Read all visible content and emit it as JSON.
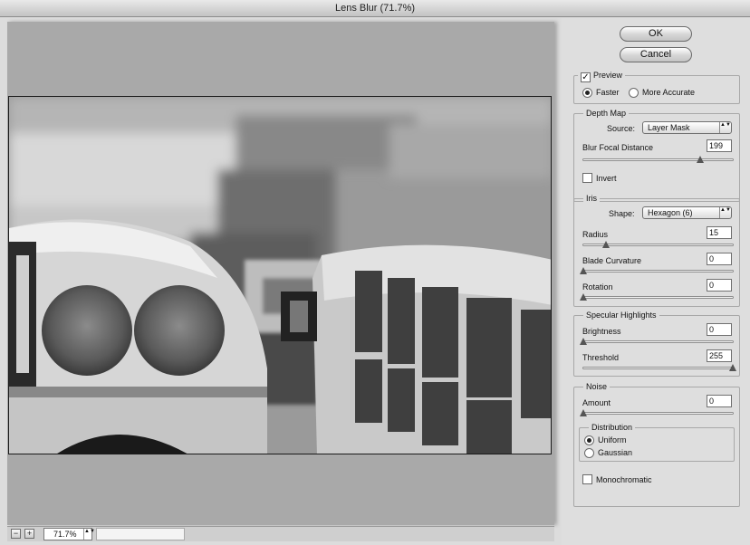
{
  "window": {
    "title": "Lens Blur (71.7%)"
  },
  "statusbar": {
    "zoom_out": "−",
    "zoom_in": "+",
    "zoom_value": "71.7%",
    "stepper": "▲▼"
  },
  "buttons": {
    "ok": "OK",
    "cancel": "Cancel"
  },
  "preview": {
    "label": "Preview",
    "checked": true,
    "faster": "Faster",
    "more_accurate": "More Accurate",
    "mode_selected": "Faster"
  },
  "depth_map": {
    "title": "Depth Map",
    "source_label": "Source:",
    "source_value": "Layer Mask",
    "blur_focal_label": "Blur Focal Distance",
    "blur_focal_value": "199",
    "blur_focal_max": 255,
    "invert_label": "Invert",
    "invert_checked": false
  },
  "iris": {
    "title": "Iris",
    "shape_label": "Shape:",
    "shape_value": "Hexagon (6)",
    "radius_label": "Radius",
    "radius_value": "15",
    "radius_max": 100,
    "blade_label": "Blade Curvature",
    "blade_value": "0",
    "blade_max": 100,
    "rotation_label": "Rotation",
    "rotation_value": "0",
    "rotation_max": 360
  },
  "specular": {
    "title": "Specular Highlights",
    "brightness_label": "Brightness",
    "brightness_value": "0",
    "brightness_max": 100,
    "threshold_label": "Threshold",
    "threshold_value": "255",
    "threshold_max": 255
  },
  "noise": {
    "title": "Noise",
    "amount_label": "Amount",
    "amount_value": "0",
    "amount_max": 100,
    "distribution_title": "Distribution",
    "uniform": "Uniform",
    "gaussian": "Gaussian",
    "distribution_selected": "Uniform",
    "monochromatic_label": "Monochromatic",
    "monochromatic_checked": false
  },
  "icons": {
    "checkmark": "✓",
    "select_arrows": "▲▼"
  }
}
